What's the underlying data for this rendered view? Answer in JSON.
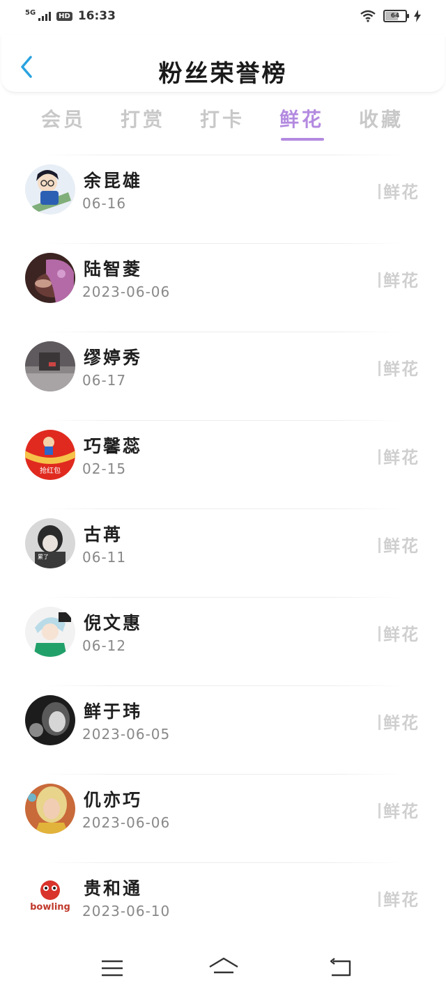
{
  "status_bar": {
    "network": "5G",
    "hd": "HD",
    "time": "16:33",
    "battery": "64"
  },
  "header": {
    "title": "粉丝荣誉榜"
  },
  "tabs": [
    {
      "label": "会员",
      "active": false
    },
    {
      "label": "打赏",
      "active": false
    },
    {
      "label": "打卡",
      "active": false
    },
    {
      "label": "鲜花",
      "active": true
    },
    {
      "label": "收藏",
      "active": false
    }
  ],
  "list": [
    {
      "name": "余昆雄",
      "date": "06-16",
      "tag": "鲜花",
      "avatar": "anime-boy-blue"
    },
    {
      "name": "陆智菱",
      "date": "2023-06-06",
      "tag": "鲜花",
      "avatar": "dark-photo"
    },
    {
      "name": "缪婷秀",
      "date": "06-17",
      "tag": "鲜花",
      "avatar": "grey-room"
    },
    {
      "name": "巧馨蕊",
      "date": "02-15",
      "tag": "鲜花",
      "avatar": "red-envelope",
      "avatar_text": "抢红包"
    },
    {
      "name": "古苒",
      "date": "06-11",
      "tag": "鲜花",
      "avatar": "bw-girl",
      "avatar_text": "累了"
    },
    {
      "name": "倪文惠",
      "date": "06-12",
      "tag": "鲜花",
      "avatar": "anime-silver"
    },
    {
      "name": "鲜于玮",
      "date": "2023-06-05",
      "tag": "鲜花",
      "avatar": "bw-portrait"
    },
    {
      "name": "仉亦巧",
      "date": "2023-06-06",
      "tag": "鲜花",
      "avatar": "yellow-portrait"
    },
    {
      "name": "贵和通",
      "date": "2023-06-10",
      "tag": "鲜花",
      "avatar": "bowling-logo",
      "avatar_text": "bowling"
    }
  ],
  "colors": {
    "accent": "#b38ae0",
    "back_arrow": "#2aa3e0",
    "tab_inactive": "#c8c8c8"
  },
  "bottom_nav": {
    "icons": [
      "menu-icon",
      "home-icon",
      "back-icon"
    ]
  }
}
